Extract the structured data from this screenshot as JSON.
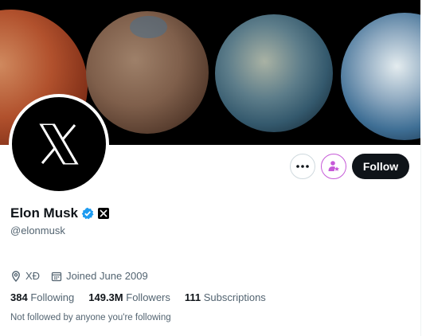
{
  "profile": {
    "name": "Elon Musk",
    "handle": "@elonmusk",
    "location": "XÐ",
    "joined": "Joined June 2009",
    "not_followed_text": "Not followed by anyone you're following"
  },
  "stats": {
    "following_count": "384",
    "following_label": "Following",
    "followers_count": "149.3M",
    "followers_label": "Followers",
    "subscriptions_count": "111",
    "subscriptions_label": "Subscriptions"
  },
  "actions": {
    "follow_label": "Follow"
  },
  "icons": {
    "more": "more-horizontal-icon",
    "subscribe": "subscribe-star-icon",
    "verified": "verified-badge-icon",
    "affiliate": "x-logo-icon",
    "location": "location-pin-icon",
    "calendar": "calendar-icon"
  },
  "colors": {
    "verified_blue": "#1d9bf0",
    "subscribe_purple": "#c65ad8",
    "text_secondary": "#536471",
    "follow_bg": "#0f1419"
  }
}
